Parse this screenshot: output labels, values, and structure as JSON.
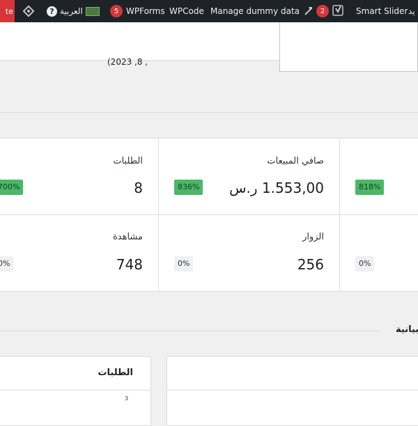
{
  "adminbar": {
    "update_label": "te",
    "wp_icon": "diamond-plugin-icon",
    "lang_label": "العربية",
    "help_icon": "question-icon",
    "wpforms_badge": "5",
    "wpforms_label": "WPForms",
    "wpcode_label": "WPCode",
    "dummy_label": "Manage dummy data",
    "hammer_icon": "hammer-icon",
    "yoast_badge": "2",
    "yoast_icon": "yoast-icon",
    "smart_slider_label": "Smart Slider",
    "cut_label": "ید"
  },
  "date_range": {
    "text": "(2023 ,8 ,"
  },
  "stats": {
    "orders": {
      "label": "الطلبات",
      "value": "8",
      "delta": "700%"
    },
    "net_sales": {
      "label": "صافي المبيعات",
      "value": "1.553,00 ر.س",
      "delta": "836%"
    },
    "third": {
      "delta": "818%"
    },
    "views": {
      "label": "مشاهدة",
      "value": "748",
      "delta": "0%"
    },
    "visitors": {
      "label": "الزوار",
      "value": "256",
      "delta": "0%"
    },
    "sixth": {
      "delta": "0%"
    }
  },
  "section": {
    "heading": "بيانية"
  },
  "panels": {
    "left_title": "الطلبات",
    "left_axis": "3"
  },
  "colors": {
    "positive": "#4ab866",
    "adminbar": "#1d2327",
    "update": "#d63638"
  }
}
